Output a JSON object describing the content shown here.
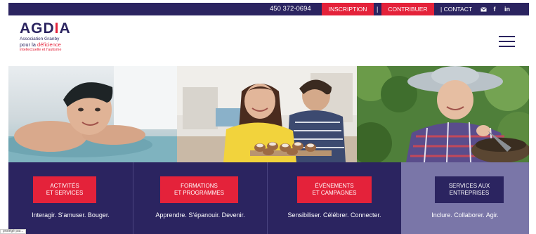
{
  "topbar": {
    "phone": "450 372-0694",
    "inscription": "INSCRIPTION",
    "separator": "|",
    "contribuer": "CONTRIBUER",
    "contact": "| CONTACT",
    "icons": [
      "mail-icon",
      "facebook-icon",
      "linkedin-icon"
    ],
    "facebook_glyph": "f",
    "linkedin_glyph": "in"
  },
  "logo": {
    "mark_start": "AGD",
    "mark_highlight": "I",
    "mark_end": "A",
    "line1": "Association Granby",
    "line2_start": "pour la ",
    "line2_highlight": "déficience",
    "line3": "intellectuelle et l'autisme"
  },
  "tiles": [
    {
      "cta_line1": "ACTIVITÉS",
      "cta_line2": "ET SERVICES",
      "tagline": "Interagir. S'amuser. Bouger."
    },
    {
      "cta_line1": "FORMATIONS",
      "cta_line2": "ET PROGRAMMES",
      "tagline": "Apprendre. S'épanouir. Devenir."
    },
    {
      "cta_line1": "ÉVÉNEMENTS",
      "cta_line2": "ET CAMPAGNES",
      "tagline": "Sensibiliser. Célébrer. Connecter."
    },
    {
      "cta_line1": "SERVICES AUX",
      "cta_line2": "ENTREPRISES",
      "tagline": "Inclure. Collaborer. Agir."
    }
  ],
  "badge": "protégé par...",
  "colors": {
    "navy": "#2b2460",
    "red": "#e4223a",
    "lavender": "#7a76a8"
  }
}
